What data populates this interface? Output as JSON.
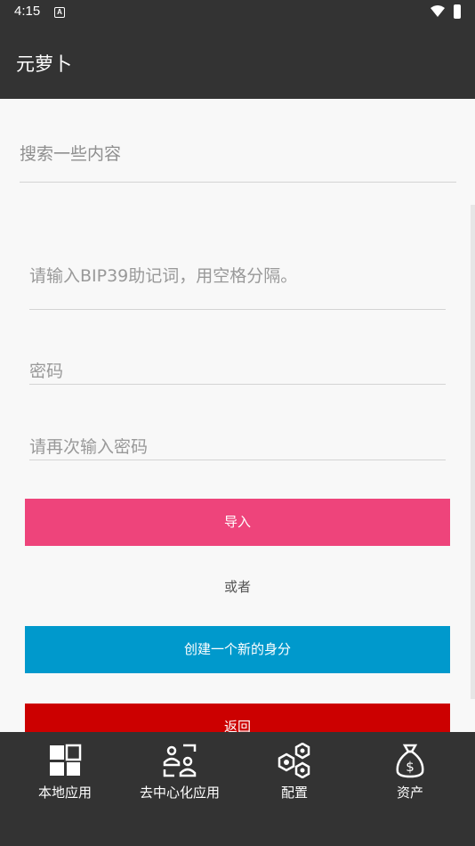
{
  "status_bar": {
    "time": "4:15",
    "notification_letter": "A"
  },
  "app_bar": {
    "title": "元萝卜"
  },
  "search": {
    "placeholder": "搜索一些内容"
  },
  "form": {
    "mnemonic_placeholder": "请输入BIP39助记词，用空格分隔。",
    "password_placeholder": "密码",
    "confirm_password_placeholder": "请再次输入密码",
    "import_label": "导入",
    "or_label": "或者",
    "create_label": "创建一个新的身分",
    "back_label": "返回"
  },
  "bottom_nav": {
    "items": [
      {
        "label": "本地应用",
        "icon": "grid-apps-icon"
      },
      {
        "label": "去中心化应用",
        "icon": "decentralized-users-icon"
      },
      {
        "label": "配置",
        "icon": "hexagon-nodes-icon"
      },
      {
        "label": "资产",
        "icon": "money-bag-icon"
      }
    ]
  },
  "colors": {
    "bar": "#333333",
    "import_button": "#ee447b",
    "create_button": "#0099cc",
    "back_button": "#cc0000"
  }
}
